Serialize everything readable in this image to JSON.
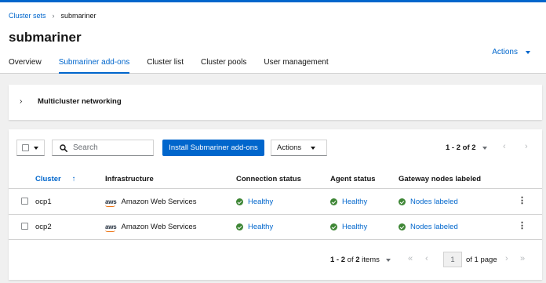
{
  "breadcrumb": {
    "parent": "Cluster sets",
    "separator": "›",
    "current": "submariner"
  },
  "page": {
    "title": "submariner",
    "actions_label": "Actions"
  },
  "tabs": [
    {
      "label": "Overview",
      "active": false
    },
    {
      "label": "Submariner add-ons",
      "active": true
    },
    {
      "label": "Cluster list",
      "active": false
    },
    {
      "label": "Cluster pools",
      "active": false
    },
    {
      "label": "User management",
      "active": false
    }
  ],
  "networking_card": {
    "title": "Multicluster networking",
    "toggle_icon": "›"
  },
  "toolbar": {
    "search_placeholder": "Search",
    "install_button": "Install Submariner add-ons",
    "actions_label": "Actions",
    "pagination_top": "1 - 2 of 2"
  },
  "table": {
    "columns": [
      "Cluster",
      "Infrastructure",
      "Connection status",
      "Agent status",
      "Gateway nodes labeled"
    ],
    "sort_icon": "↑",
    "rows": [
      {
        "cluster": "ocp1",
        "infra_logo": "aws",
        "infrastructure": "Amazon Web Services",
        "connection": "Healthy",
        "agent": "Healthy",
        "gateway": "Nodes labeled"
      },
      {
        "cluster": "ocp2",
        "infra_logo": "aws",
        "infrastructure": "Amazon Web Services",
        "connection": "Healthy",
        "agent": "Healthy",
        "gateway": "Nodes labeled"
      }
    ]
  },
  "pagination_bottom": {
    "range_prefix": "1 - 2",
    "of_text": "of",
    "total": "2",
    "items_suffix": "items",
    "current_page": "1",
    "of_pages": "of 1 page"
  },
  "icons": {
    "prev": "‹",
    "next": "›",
    "first": "«",
    "last": "»",
    "kebab": "⋮",
    "search": "search-icon"
  },
  "colors": {
    "accent": "#0066cc",
    "success": "#3e8635",
    "aws_orange": "#ec7211"
  }
}
